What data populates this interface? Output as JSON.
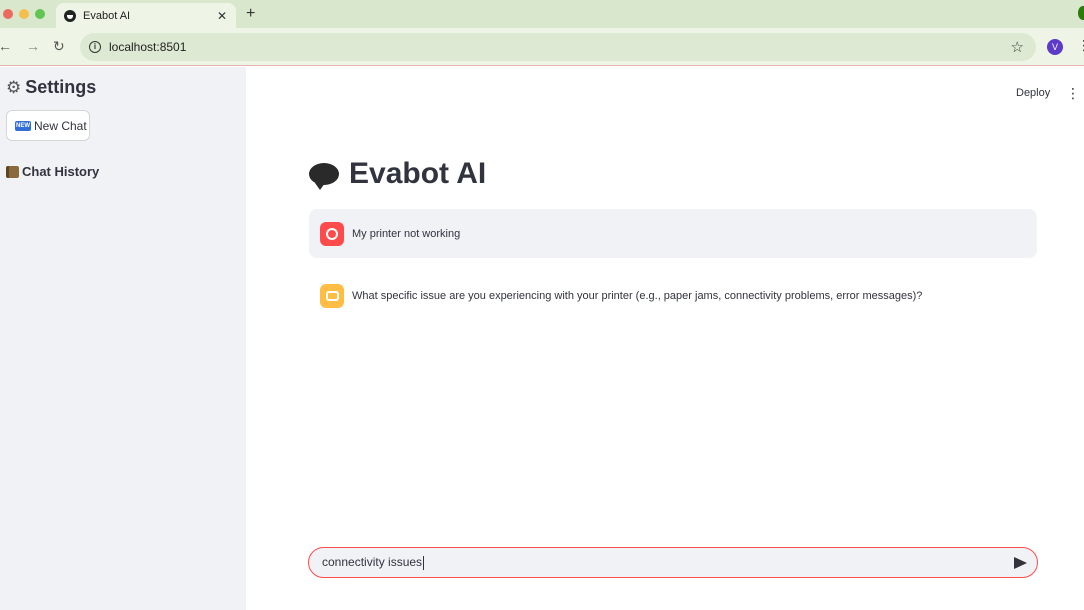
{
  "browser": {
    "tab_title": "Evabot AI",
    "tab_close": "✕",
    "new_tab": "+",
    "url": "localhost:8501",
    "profile_initial": "V"
  },
  "sidebar": {
    "settings_title": "Settings",
    "new_chat_icon": "NEW",
    "new_chat_label": "New Chat",
    "chat_history_title": "Chat History"
  },
  "header": {
    "deploy_label": "Deploy"
  },
  "main": {
    "title": "Evabot AI",
    "messages": [
      {
        "role": "user",
        "text": "My printer not working"
      },
      {
        "role": "assistant",
        "text": "What specific issue are you experiencing with your printer (e.g., paper jams, connectivity problems, error messages)?"
      }
    ],
    "chat_input_value": "connectivity issues"
  },
  "colors": {
    "accent": "#ff4b4b",
    "assistant_avatar": "#ffbd45",
    "sidebar_bg": "#f0f2f6",
    "text": "#31333f"
  }
}
